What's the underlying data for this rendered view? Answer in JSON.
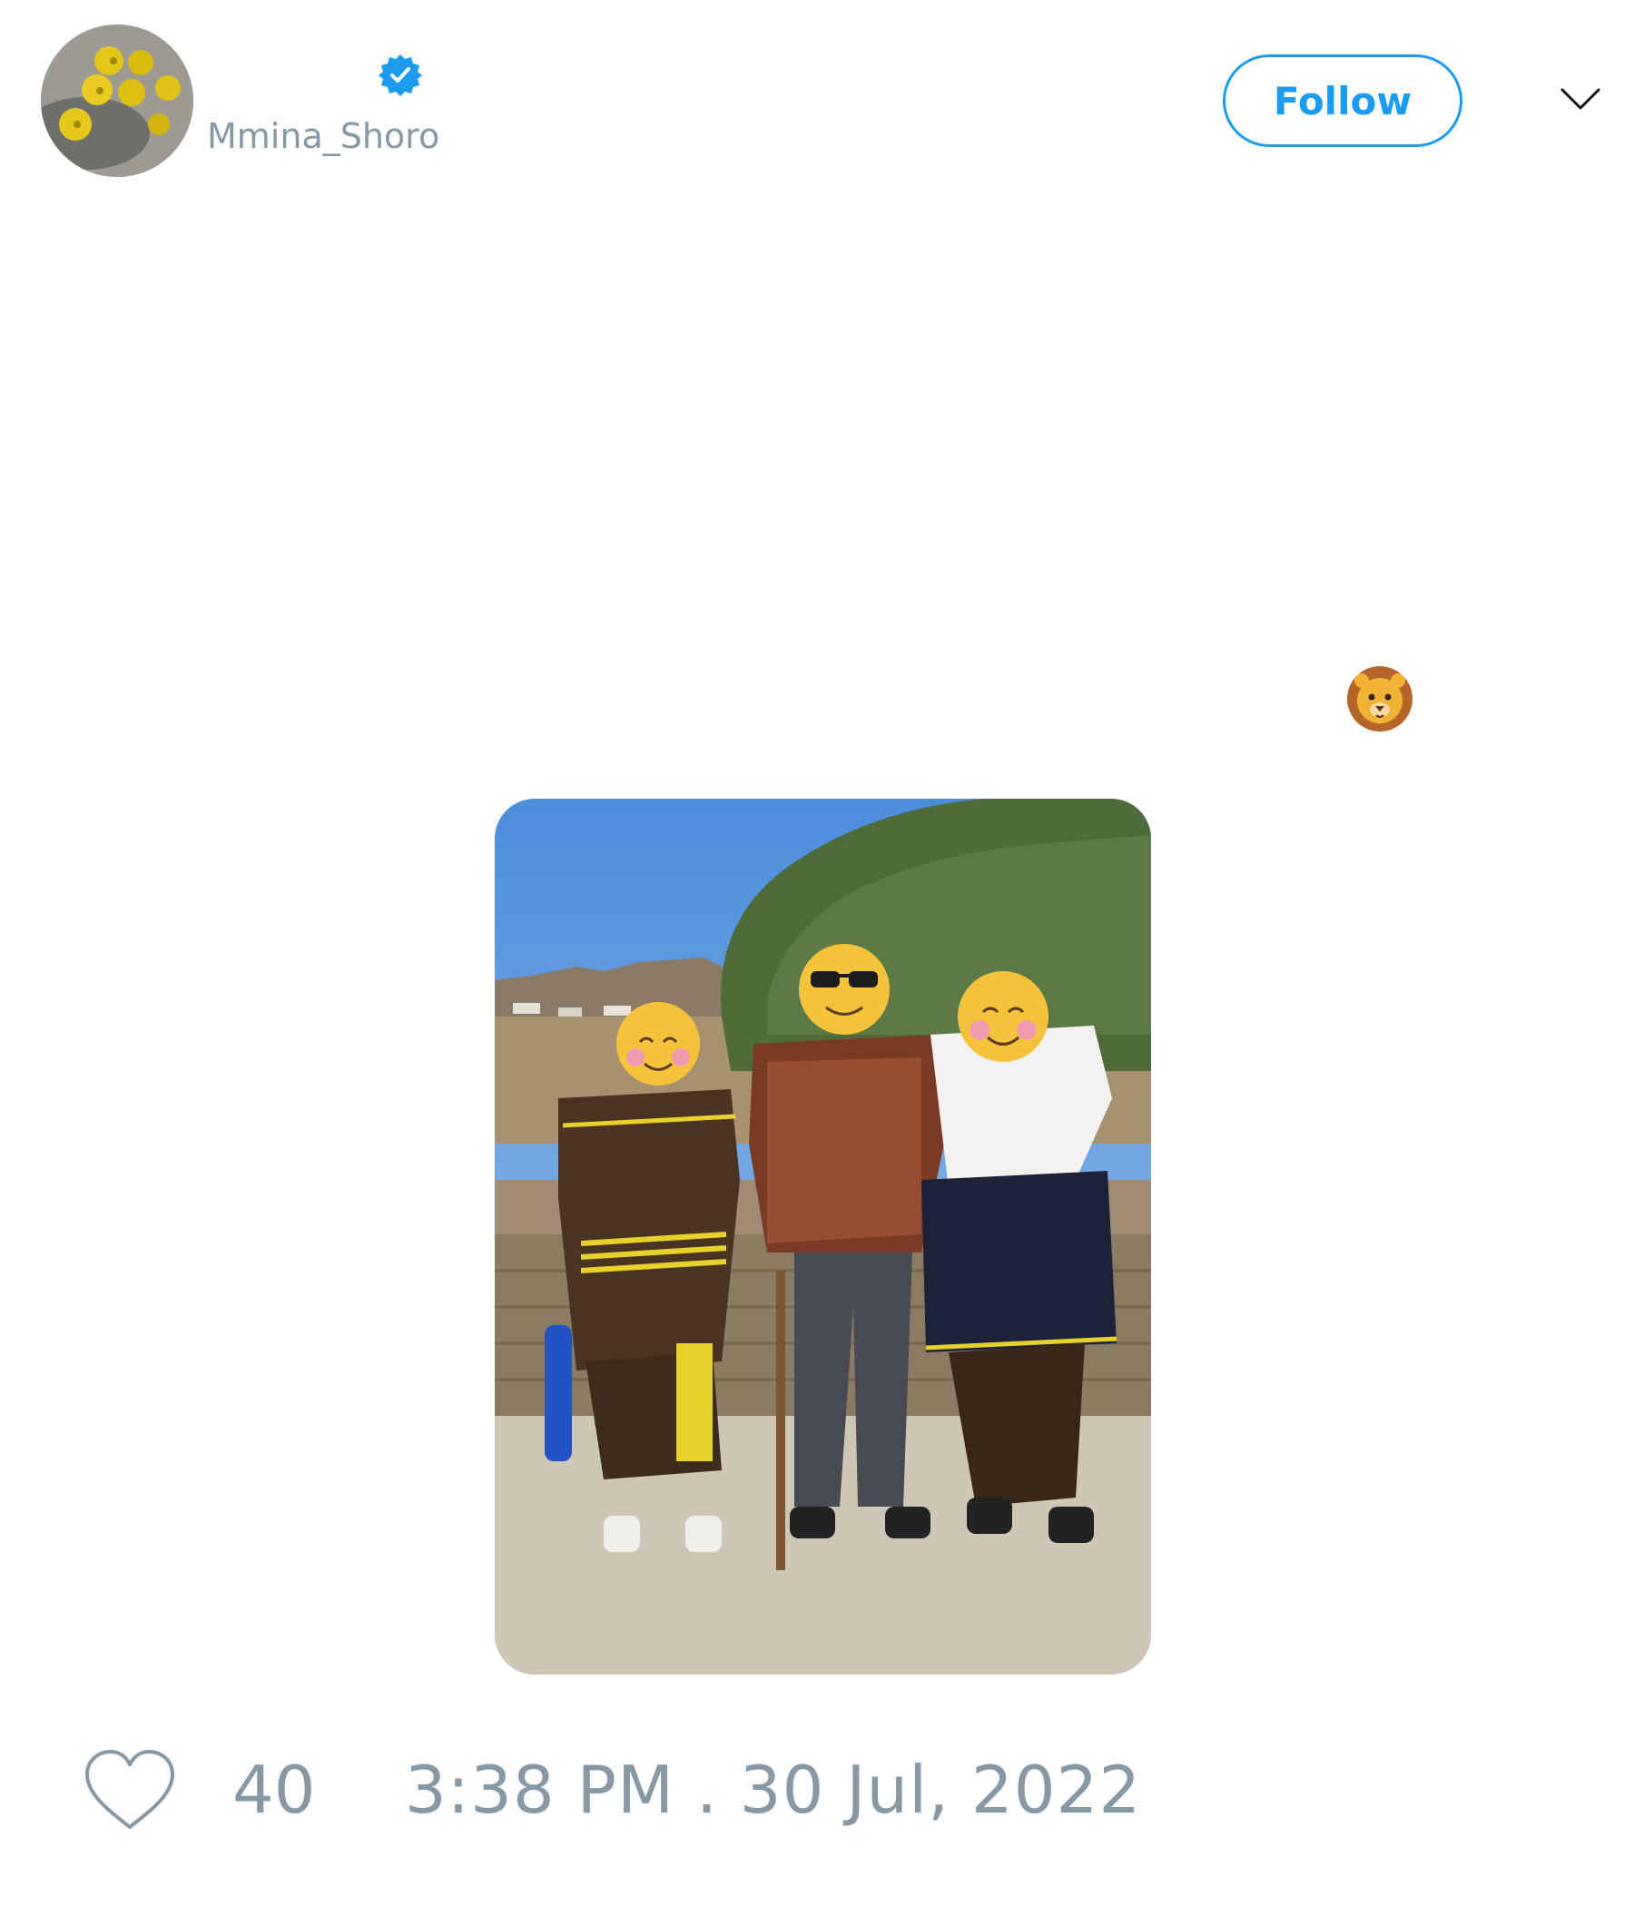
{
  "header": {
    "handle": "Mmina_Shoro",
    "verified_icon": "verified-badge-icon",
    "follow_label": "Follow",
    "menu_icon": "chevron-down-icon"
  },
  "body": {
    "emoji": "lion-face-emoji"
  },
  "media": {
    "photo": "photo of three people in traditional attire with emoji-covered faces"
  },
  "footer": {
    "like_icon": "heart-icon",
    "like_count": "40",
    "timestamp": "3:38 PM . 30 Jul, 2022"
  },
  "colors": {
    "accent": "#1d9bf0",
    "muted": "#8899a6"
  }
}
